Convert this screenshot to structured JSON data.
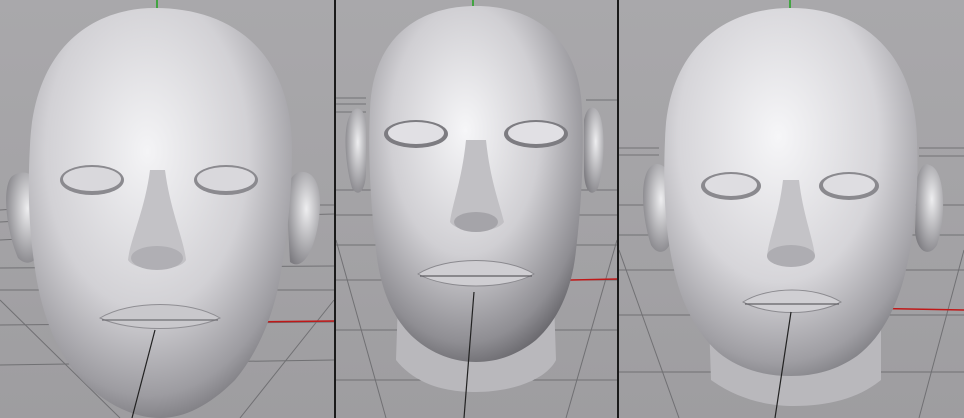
{
  "viewports": [
    {
      "id": "vp-1",
      "label": "",
      "subject": "head-model-1"
    },
    {
      "id": "vp-2",
      "label": "",
      "subject": "head-model-2"
    },
    {
      "id": "vp-3",
      "label": "",
      "subject": "head-model-3"
    }
  ],
  "colors": {
    "background": "#a6a5a8",
    "grid_line": "#5a5a5c",
    "axis_y": "#1fa31f",
    "axis_x": "#c01818",
    "axis_z": "#222222",
    "skin_light": "#f2f2f4",
    "skin_mid": "#bdbcc0",
    "skin_dark": "#6f6e73"
  }
}
